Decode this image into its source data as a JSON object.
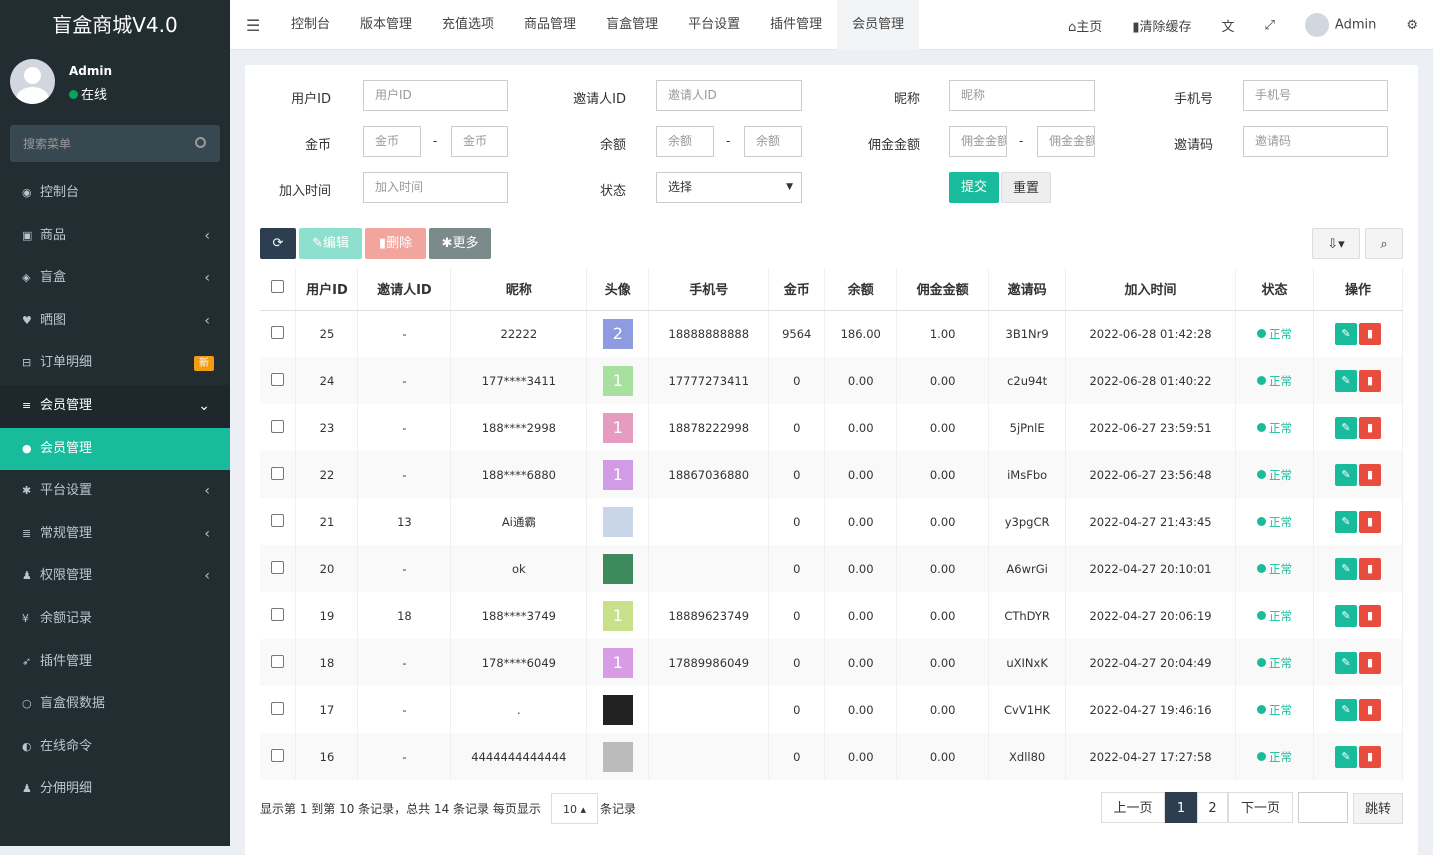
{
  "sidebar": {
    "logo": "盲盒商城V4.0",
    "user": {
      "name": "Admin",
      "status": "在线"
    },
    "search_placeholder": "搜索菜单",
    "items": [
      {
        "icon": "dashboard-icon",
        "glyph": "◉",
        "label": "控制台",
        "arrow": ""
      },
      {
        "icon": "shopping-bag-icon",
        "glyph": "▣",
        "label": "商品",
        "arrow": "‹"
      },
      {
        "icon": "cube-icon",
        "glyph": "◈",
        "label": "盲盒",
        "arrow": "‹"
      },
      {
        "icon": "heart-icon",
        "glyph": "♥",
        "label": "晒图",
        "arrow": "‹"
      },
      {
        "icon": "cart-icon",
        "glyph": "⊟",
        "label": "订单明细",
        "arrow": "",
        "badge": "新"
      },
      {
        "icon": "list-icon",
        "glyph": "≡",
        "label": "会员管理",
        "arrow": "⌄"
      },
      {
        "icon": "user-icon",
        "glyph": "●",
        "label": "会员管理",
        "arrow": ""
      },
      {
        "icon": "gear-icon",
        "glyph": "✱",
        "label": "平台设置",
        "arrow": "‹"
      },
      {
        "icon": "database-icon",
        "glyph": "≣",
        "label": "常规管理",
        "arrow": "‹"
      },
      {
        "icon": "group-icon",
        "glyph": "♟",
        "label": "权限管理",
        "arrow": "‹"
      },
      {
        "icon": "yen-icon",
        "glyph": "¥",
        "label": "余额记录",
        "arrow": ""
      },
      {
        "icon": "rocket-icon",
        "glyph": "➶",
        "label": "插件管理",
        "arrow": ""
      },
      {
        "icon": "circle-icon",
        "glyph": "○",
        "label": "盲盒假数据",
        "arrow": ""
      },
      {
        "icon": "half-circle-icon",
        "glyph": "◐",
        "label": "在线命令",
        "arrow": ""
      },
      {
        "icon": "group-icon",
        "glyph": "♟",
        "label": "分佣明细",
        "arrow": ""
      }
    ]
  },
  "topbar": {
    "tabs": [
      "控制台",
      "版本管理",
      "充值选项",
      "商品管理",
      "盲盒管理",
      "平台设置",
      "插件管理",
      "会员管理"
    ],
    "home": "主页",
    "clear_cache": "清除缓存",
    "admin": "Admin"
  },
  "filter": {
    "user_id": {
      "label": "用户ID",
      "placeholder": "用户ID"
    },
    "inviter_id": {
      "label": "邀请人ID",
      "placeholder": "邀请人ID"
    },
    "nickname": {
      "label": "昵称",
      "placeholder": "昵称"
    },
    "phone": {
      "label": "手机号",
      "placeholder": "手机号"
    },
    "coins": {
      "label": "金币",
      "placeholder": "金币"
    },
    "balance": {
      "label": "余额",
      "placeholder": "余额"
    },
    "commission": {
      "label": "佣金金额",
      "placeholder": "佣金金额"
    },
    "invite_code": {
      "label": "邀请码",
      "placeholder": "邀请码"
    },
    "join_time": {
      "label": "加入时间",
      "placeholder": "加入时间"
    },
    "status": {
      "label": "状态",
      "value": "选择"
    },
    "submit": "提交",
    "reset": "重置"
  },
  "toolbar": {
    "edit": "编辑",
    "delete": "删除",
    "more": "更多"
  },
  "table": {
    "headers": [
      "用户ID",
      "邀请人ID",
      "昵称",
      "头像",
      "手机号",
      "金币",
      "余额",
      "佣金金额",
      "邀请码",
      "加入时间",
      "状态",
      "操作"
    ],
    "rows": [
      {
        "id": "25",
        "inviter": "-",
        "nick": "22222",
        "avatar": "2",
        "avcolor": "#8e9be0",
        "phone": "18888888888",
        "coins": "9564",
        "balance": "186.00",
        "comm": "1.00",
        "code": "3B1Nr9",
        "time": "2022-06-28 01:42:28",
        "status": "正常"
      },
      {
        "id": "24",
        "inviter": "-",
        "nick": "177****3411",
        "avatar": "1",
        "avcolor": "#a8e0a0",
        "phone": "17777273411",
        "coins": "0",
        "balance": "0.00",
        "comm": "0.00",
        "code": "c2u94t",
        "time": "2022-06-28 01:40:22",
        "status": "正常"
      },
      {
        "id": "23",
        "inviter": "-",
        "nick": "188****2998",
        "avatar": "1",
        "avcolor": "#e69bc0",
        "phone": "18878222998",
        "coins": "0",
        "balance": "0.00",
        "comm": "0.00",
        "code": "5jPnlE",
        "time": "2022-06-27 23:59:51",
        "status": "正常"
      },
      {
        "id": "22",
        "inviter": "-",
        "nick": "188****6880",
        "avatar": "1",
        "avcolor": "#d19be6",
        "phone": "18867036880",
        "coins": "0",
        "balance": "0.00",
        "comm": "0.00",
        "code": "iMsFbo",
        "time": "2022-06-27 23:56:48",
        "status": "正常"
      },
      {
        "id": "21",
        "inviter": "13",
        "nick": "Ai通霸",
        "avatar": "",
        "avcolor": "#c9d6e8",
        "phone": "",
        "coins": "0",
        "balance": "0.00",
        "comm": "0.00",
        "code": "y3pgCR",
        "time": "2022-04-27 21:43:45",
        "status": "正常"
      },
      {
        "id": "20",
        "inviter": "-",
        "nick": "ok",
        "avatar": "",
        "avcolor": "#3d8a5c",
        "phone": "",
        "coins": "0",
        "balance": "0.00",
        "comm": "0.00",
        "code": "A6wrGi",
        "time": "2022-04-27 20:10:01",
        "status": "正常"
      },
      {
        "id": "19",
        "inviter": "18",
        "nick": "188****3749",
        "avatar": "1",
        "avcolor": "#c8e08a",
        "phone": "18889623749",
        "coins": "0",
        "balance": "0.00",
        "comm": "0.00",
        "code": "CThDYR",
        "time": "2022-04-27 20:06:19",
        "status": "正常"
      },
      {
        "id": "18",
        "inviter": "-",
        "nick": "178****6049",
        "avatar": "1",
        "avcolor": "#d89be6",
        "phone": "17889986049",
        "coins": "0",
        "balance": "0.00",
        "comm": "0.00",
        "code": "uXINxK",
        "time": "2022-04-27 20:04:49",
        "status": "正常"
      },
      {
        "id": "17",
        "inviter": "-",
        "nick": ".",
        "avatar": "",
        "avcolor": "#222222",
        "phone": "",
        "coins": "0",
        "balance": "0.00",
        "comm": "0.00",
        "code": "CvV1HK",
        "time": "2022-04-27 19:46:16",
        "status": "正常"
      },
      {
        "id": "16",
        "inviter": "-",
        "nick": "4444444444444",
        "avatar": "",
        "avcolor": "#bbbbbb",
        "phone": "",
        "coins": "0",
        "balance": "0.00",
        "comm": "0.00",
        "code": "Xdll80",
        "time": "2022-04-27 17:27:58",
        "status": "正常"
      }
    ]
  },
  "pagination": {
    "summary_a": "显示第 1 到第 10 条记录，总共 14 条记录 每页显示",
    "page_size": "10",
    "summary_b": "条记录",
    "prev": "上一页",
    "pages": [
      "1",
      "2"
    ],
    "next": "下一页",
    "jump": "跳转"
  },
  "colors": {
    "accent": "#18bc9c",
    "sidebar": "#222d32",
    "dark_btn": "#2c3e50",
    "danger": "#e74c3c",
    "success": "#18bc9c"
  }
}
